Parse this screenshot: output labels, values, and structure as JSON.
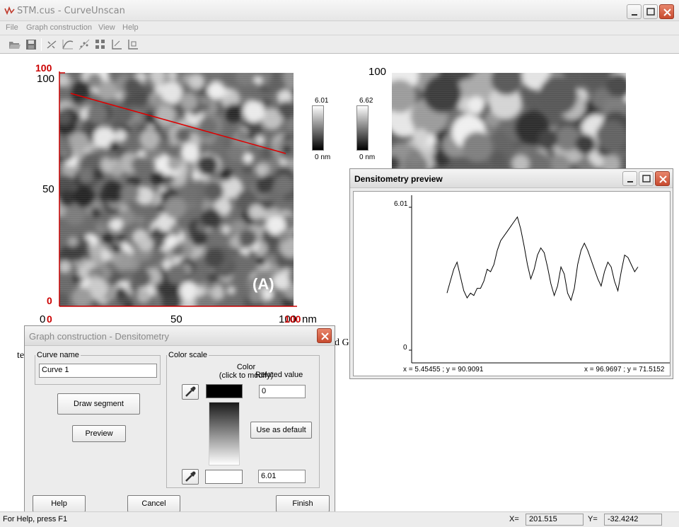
{
  "window": {
    "title": "STM.cus - CurveUnscan",
    "icon": "curveunscan-logo-icon"
  },
  "menu": [
    "File",
    "Graph construction",
    "View",
    "Help"
  ],
  "toolbar_icons": [
    "open-folder-icon",
    "save-icon",
    "sep",
    "points-icon",
    "curve-icon",
    "scatter-icon",
    "grid-icon",
    "axis-x-icon",
    "axis-y-icon"
  ],
  "plot": {
    "y_top_red": "100",
    "y_top_black": "100",
    "y_mid": "50",
    "y_zero_red": "0",
    "x_zero_black": "0",
    "x_zero_red": "0",
    "x_mid": "50",
    "x_end_black": "100",
    "x_end_red": "100",
    "unit": "nm",
    "label_A": "(A)",
    "partial_left": "te",
    "partial_right": "d G",
    "right_top": "100"
  },
  "colorbars": [
    {
      "top": "6.01",
      "bottom": "0 nm"
    },
    {
      "top": "6.62",
      "bottom": "0 nm"
    }
  ],
  "densitometry": {
    "title": "Densitometry preview",
    "y_max": "6.01",
    "y_min": "0",
    "left_readout": "x = 5.45455 ; y = 90.9091",
    "right_readout": "x = 96.9697 ; y = 71.5152",
    "profile": [
      2.4,
      2.9,
      3.4,
      3.7,
      3.1,
      2.5,
      2.2,
      2.4,
      2.3,
      2.6,
      2.6,
      2.9,
      3.4,
      3.3,
      3.6,
      4.2,
      4.6,
      4.8,
      5.0,
      5.2,
      5.4,
      5.6,
      5.1,
      4.4,
      3.6,
      3.0,
      3.4,
      4.0,
      4.3,
      4.1,
      3.5,
      2.8,
      2.3,
      2.7,
      3.5,
      3.2,
      2.4,
      2.1,
      2.6,
      3.6,
      4.2,
      4.5,
      4.2,
      3.8,
      3.4,
      3.0,
      2.7,
      3.3,
      3.7,
      3.5,
      2.9,
      2.5,
      3.3,
      4.0,
      3.9,
      3.6,
      3.3,
      3.5
    ]
  },
  "dialog": {
    "title": "Graph construction - Densitometry",
    "curve_group": "Curve name",
    "curve_name": "Curve 1",
    "draw_segment": "Draw segment",
    "preview": "Preview",
    "color_group": "Color scale",
    "color_header_1": "Color",
    "color_header_2": "(click to modify)",
    "related_header": "Related value",
    "top_value": "0",
    "bottom_value": "6.01",
    "use_default": "Use as default",
    "help": "Help",
    "cancel": "Cancel",
    "finish": "Finish"
  },
  "status": {
    "hint": "For Help, press F1",
    "x_label": "X=",
    "x_value": "201.515",
    "y_label": "Y=",
    "y_value": "-32.4242"
  },
  "colors": {
    "axis_red": "#cc0000",
    "selection_line": "#dd0000"
  }
}
